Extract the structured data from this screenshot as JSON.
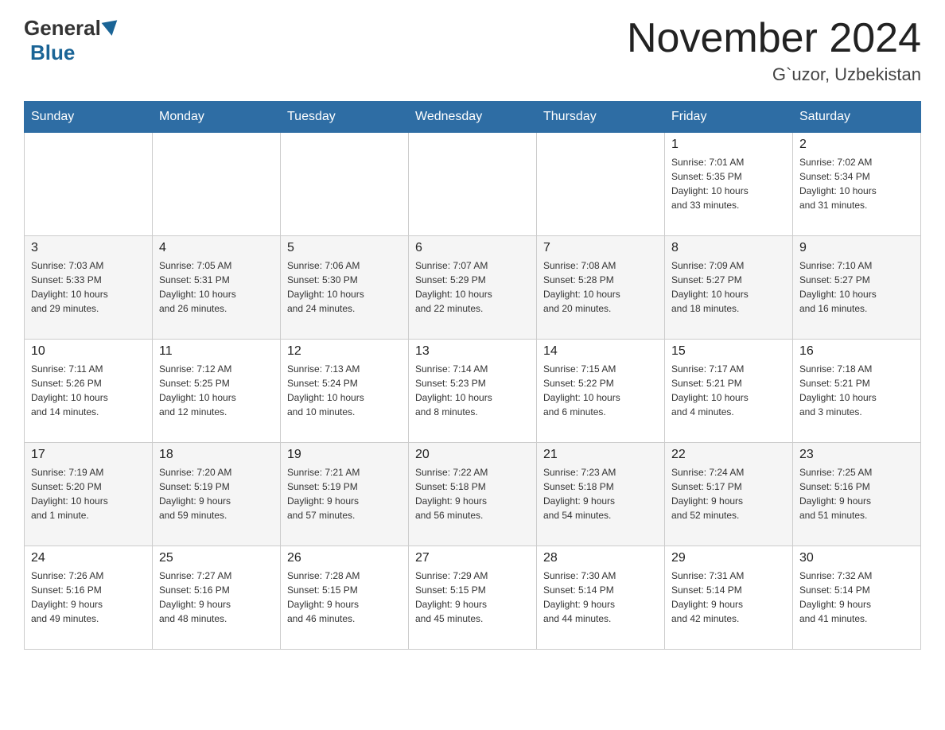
{
  "header": {
    "logo_general": "General",
    "logo_blue": "Blue",
    "month_title": "November 2024",
    "location": "G`uzor, Uzbekistan"
  },
  "days_of_week": [
    "Sunday",
    "Monday",
    "Tuesday",
    "Wednesday",
    "Thursday",
    "Friday",
    "Saturday"
  ],
  "weeks": [
    [
      {
        "day": "",
        "info": ""
      },
      {
        "day": "",
        "info": ""
      },
      {
        "day": "",
        "info": ""
      },
      {
        "day": "",
        "info": ""
      },
      {
        "day": "",
        "info": ""
      },
      {
        "day": "1",
        "info": "Sunrise: 7:01 AM\nSunset: 5:35 PM\nDaylight: 10 hours\nand 33 minutes."
      },
      {
        "day": "2",
        "info": "Sunrise: 7:02 AM\nSunset: 5:34 PM\nDaylight: 10 hours\nand 31 minutes."
      }
    ],
    [
      {
        "day": "3",
        "info": "Sunrise: 7:03 AM\nSunset: 5:33 PM\nDaylight: 10 hours\nand 29 minutes."
      },
      {
        "day": "4",
        "info": "Sunrise: 7:05 AM\nSunset: 5:31 PM\nDaylight: 10 hours\nand 26 minutes."
      },
      {
        "day": "5",
        "info": "Sunrise: 7:06 AM\nSunset: 5:30 PM\nDaylight: 10 hours\nand 24 minutes."
      },
      {
        "day": "6",
        "info": "Sunrise: 7:07 AM\nSunset: 5:29 PM\nDaylight: 10 hours\nand 22 minutes."
      },
      {
        "day": "7",
        "info": "Sunrise: 7:08 AM\nSunset: 5:28 PM\nDaylight: 10 hours\nand 20 minutes."
      },
      {
        "day": "8",
        "info": "Sunrise: 7:09 AM\nSunset: 5:27 PM\nDaylight: 10 hours\nand 18 minutes."
      },
      {
        "day": "9",
        "info": "Sunrise: 7:10 AM\nSunset: 5:27 PM\nDaylight: 10 hours\nand 16 minutes."
      }
    ],
    [
      {
        "day": "10",
        "info": "Sunrise: 7:11 AM\nSunset: 5:26 PM\nDaylight: 10 hours\nand 14 minutes."
      },
      {
        "day": "11",
        "info": "Sunrise: 7:12 AM\nSunset: 5:25 PM\nDaylight: 10 hours\nand 12 minutes."
      },
      {
        "day": "12",
        "info": "Sunrise: 7:13 AM\nSunset: 5:24 PM\nDaylight: 10 hours\nand 10 minutes."
      },
      {
        "day": "13",
        "info": "Sunrise: 7:14 AM\nSunset: 5:23 PM\nDaylight: 10 hours\nand 8 minutes."
      },
      {
        "day": "14",
        "info": "Sunrise: 7:15 AM\nSunset: 5:22 PM\nDaylight: 10 hours\nand 6 minutes."
      },
      {
        "day": "15",
        "info": "Sunrise: 7:17 AM\nSunset: 5:21 PM\nDaylight: 10 hours\nand 4 minutes."
      },
      {
        "day": "16",
        "info": "Sunrise: 7:18 AM\nSunset: 5:21 PM\nDaylight: 10 hours\nand 3 minutes."
      }
    ],
    [
      {
        "day": "17",
        "info": "Sunrise: 7:19 AM\nSunset: 5:20 PM\nDaylight: 10 hours\nand 1 minute."
      },
      {
        "day": "18",
        "info": "Sunrise: 7:20 AM\nSunset: 5:19 PM\nDaylight: 9 hours\nand 59 minutes."
      },
      {
        "day": "19",
        "info": "Sunrise: 7:21 AM\nSunset: 5:19 PM\nDaylight: 9 hours\nand 57 minutes."
      },
      {
        "day": "20",
        "info": "Sunrise: 7:22 AM\nSunset: 5:18 PM\nDaylight: 9 hours\nand 56 minutes."
      },
      {
        "day": "21",
        "info": "Sunrise: 7:23 AM\nSunset: 5:18 PM\nDaylight: 9 hours\nand 54 minutes."
      },
      {
        "day": "22",
        "info": "Sunrise: 7:24 AM\nSunset: 5:17 PM\nDaylight: 9 hours\nand 52 minutes."
      },
      {
        "day": "23",
        "info": "Sunrise: 7:25 AM\nSunset: 5:16 PM\nDaylight: 9 hours\nand 51 minutes."
      }
    ],
    [
      {
        "day": "24",
        "info": "Sunrise: 7:26 AM\nSunset: 5:16 PM\nDaylight: 9 hours\nand 49 minutes."
      },
      {
        "day": "25",
        "info": "Sunrise: 7:27 AM\nSunset: 5:16 PM\nDaylight: 9 hours\nand 48 minutes."
      },
      {
        "day": "26",
        "info": "Sunrise: 7:28 AM\nSunset: 5:15 PM\nDaylight: 9 hours\nand 46 minutes."
      },
      {
        "day": "27",
        "info": "Sunrise: 7:29 AM\nSunset: 5:15 PM\nDaylight: 9 hours\nand 45 minutes."
      },
      {
        "day": "28",
        "info": "Sunrise: 7:30 AM\nSunset: 5:14 PM\nDaylight: 9 hours\nand 44 minutes."
      },
      {
        "day": "29",
        "info": "Sunrise: 7:31 AM\nSunset: 5:14 PM\nDaylight: 9 hours\nand 42 minutes."
      },
      {
        "day": "30",
        "info": "Sunrise: 7:32 AM\nSunset: 5:14 PM\nDaylight: 9 hours\nand 41 minutes."
      }
    ]
  ]
}
